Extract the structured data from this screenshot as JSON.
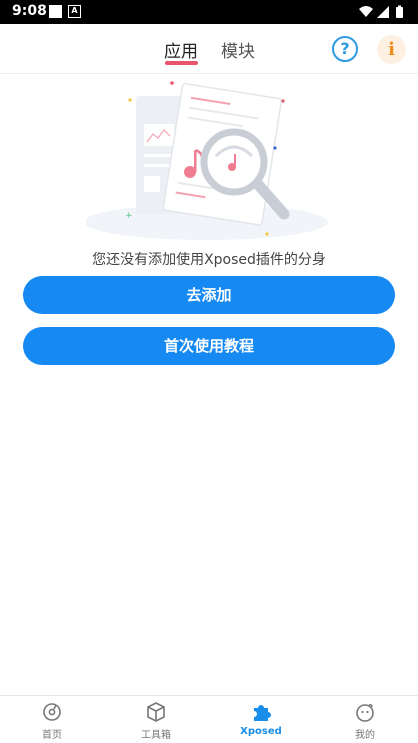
{
  "status_bar": {
    "time": "9:08",
    "notification_letter": "A"
  },
  "header": {
    "tabs": [
      {
        "label": "应用",
        "active": true
      },
      {
        "label": "模块",
        "active": false
      }
    ],
    "help_symbol": "?",
    "info_symbol": "i"
  },
  "main": {
    "empty_message": "您还没有添加使用Xposed插件的分身",
    "add_button": "去添加",
    "tutorial_button": "首次使用教程"
  },
  "bottom_nav": {
    "items": [
      {
        "label": "首页",
        "icon": "home-disc-icon",
        "active": false
      },
      {
        "label": "工具箱",
        "icon": "toolbox-cube-icon",
        "active": false
      },
      {
        "label": "Xposed",
        "icon": "puzzle-icon",
        "active": true
      },
      {
        "label": "我的",
        "icon": "face-icon",
        "active": false
      }
    ]
  },
  "colors": {
    "accent": "#1689f3",
    "tab_indicator": "#e8566a",
    "help_blue": "#2b9be6",
    "info_orange": "#f08c1c"
  }
}
